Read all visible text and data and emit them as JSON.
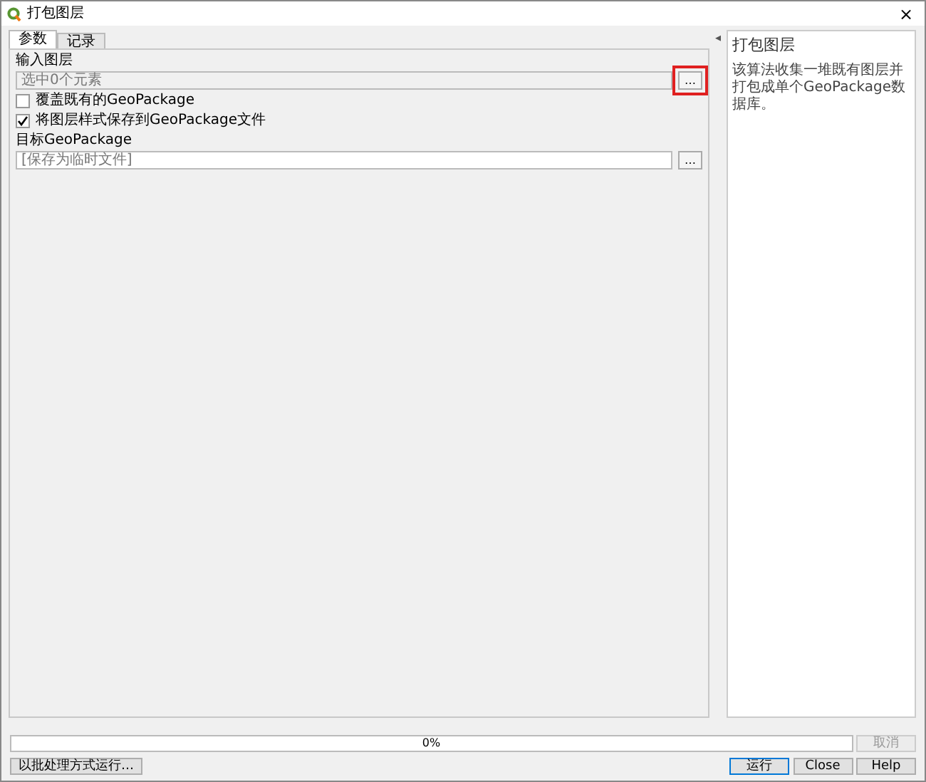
{
  "window": {
    "title": "打包图层",
    "close": "×"
  },
  "tabs": [
    {
      "label": "参数",
      "selected": true
    },
    {
      "label": "记录",
      "selected": false
    }
  ],
  "parameters": [
    {
      "kind": "picker",
      "label": "输入图层",
      "value": "选中0个元素",
      "button": "…",
      "highlighted": true
    },
    {
      "kind": "checkbox",
      "label": "覆盖既有的GeoPackage",
      "checked": false
    },
    {
      "kind": "checkbox",
      "label": "将图层样式保存到GeoPackage文件",
      "checked": true
    },
    {
      "kind": "field",
      "label": "目标GeoPackage",
      "value": "[保存为临时文件]",
      "button": "…"
    }
  ],
  "collapse_arrow": "◂",
  "help": {
    "title": "打包图层",
    "text": "该算法收集一堆既有图层并打包成单个GeoPackage数据库。"
  },
  "progress": {
    "level": 0,
    "reading": "0%"
  },
  "cancel_button": {
    "label": "取消",
    "disabled": true
  },
  "batch_button": "以批处理方式运行…",
  "buttons": [
    {
      "label": "运行",
      "default": true
    },
    {
      "label": "Close",
      "default": false
    },
    {
      "label": "Help",
      "default": false
    }
  ]
}
